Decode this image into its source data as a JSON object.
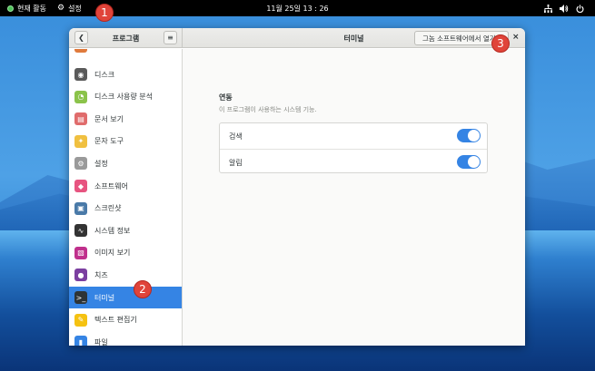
{
  "topbar": {
    "activities_label": "현재 활동",
    "settings_label": "설정",
    "clock": "11월 25일  13 : 26",
    "status_icons": [
      "network-icon",
      "volume-icon",
      "power-icon"
    ]
  },
  "window": {
    "sidebar_title": "프로그램",
    "main_title": "터미널",
    "open_in_software_label": "그놈 소프트웨어에서 열기",
    "close_glyph": "×"
  },
  "sidebar": {
    "items": [
      {
        "label": "디스크",
        "icon": "disk-icon",
        "color": "#5a5a5a"
      },
      {
        "label": "디스크 사용량 분석",
        "icon": "disk-usage-icon",
        "color": "#8bc34a"
      },
      {
        "label": "문서 보기",
        "icon": "document-viewer-icon",
        "color": "#e06c6c"
      },
      {
        "label": "문자 도구",
        "icon": "characters-icon",
        "color": "#f0c040"
      },
      {
        "label": "설정",
        "icon": "settings-icon",
        "color": "#9a9a9a"
      },
      {
        "label": "소프트웨어",
        "icon": "software-icon",
        "color": "#e75480"
      },
      {
        "label": "스크린샷",
        "icon": "screenshot-icon",
        "color": "#4a7aa8"
      },
      {
        "label": "시스템 정보",
        "icon": "system-monitor-icon",
        "color": "#333333"
      },
      {
        "label": "이미지 보기",
        "icon": "image-viewer-icon",
        "color": "#c0308c"
      },
      {
        "label": "치즈",
        "icon": "cheese-icon",
        "color": "#7b3fa0"
      },
      {
        "label": "터미널",
        "icon": "terminal-icon",
        "color": "#2e3436",
        "active": true
      },
      {
        "label": "텍스트 편집기",
        "icon": "text-editor-icon",
        "color": "#f5c211"
      },
      {
        "label": "파일",
        "icon": "files-icon",
        "color": "#3584e4"
      }
    ]
  },
  "main": {
    "section_title": "연동",
    "section_desc": "이 프로그램이 사용하는 시스템 기능.",
    "permissions": [
      {
        "label": "검색",
        "enabled": true
      },
      {
        "label": "알림",
        "enabled": true
      }
    ]
  },
  "markers": [
    "1",
    "2",
    "3"
  ],
  "colors": {
    "accent": "#3584e4",
    "marker": "#e0443a"
  }
}
